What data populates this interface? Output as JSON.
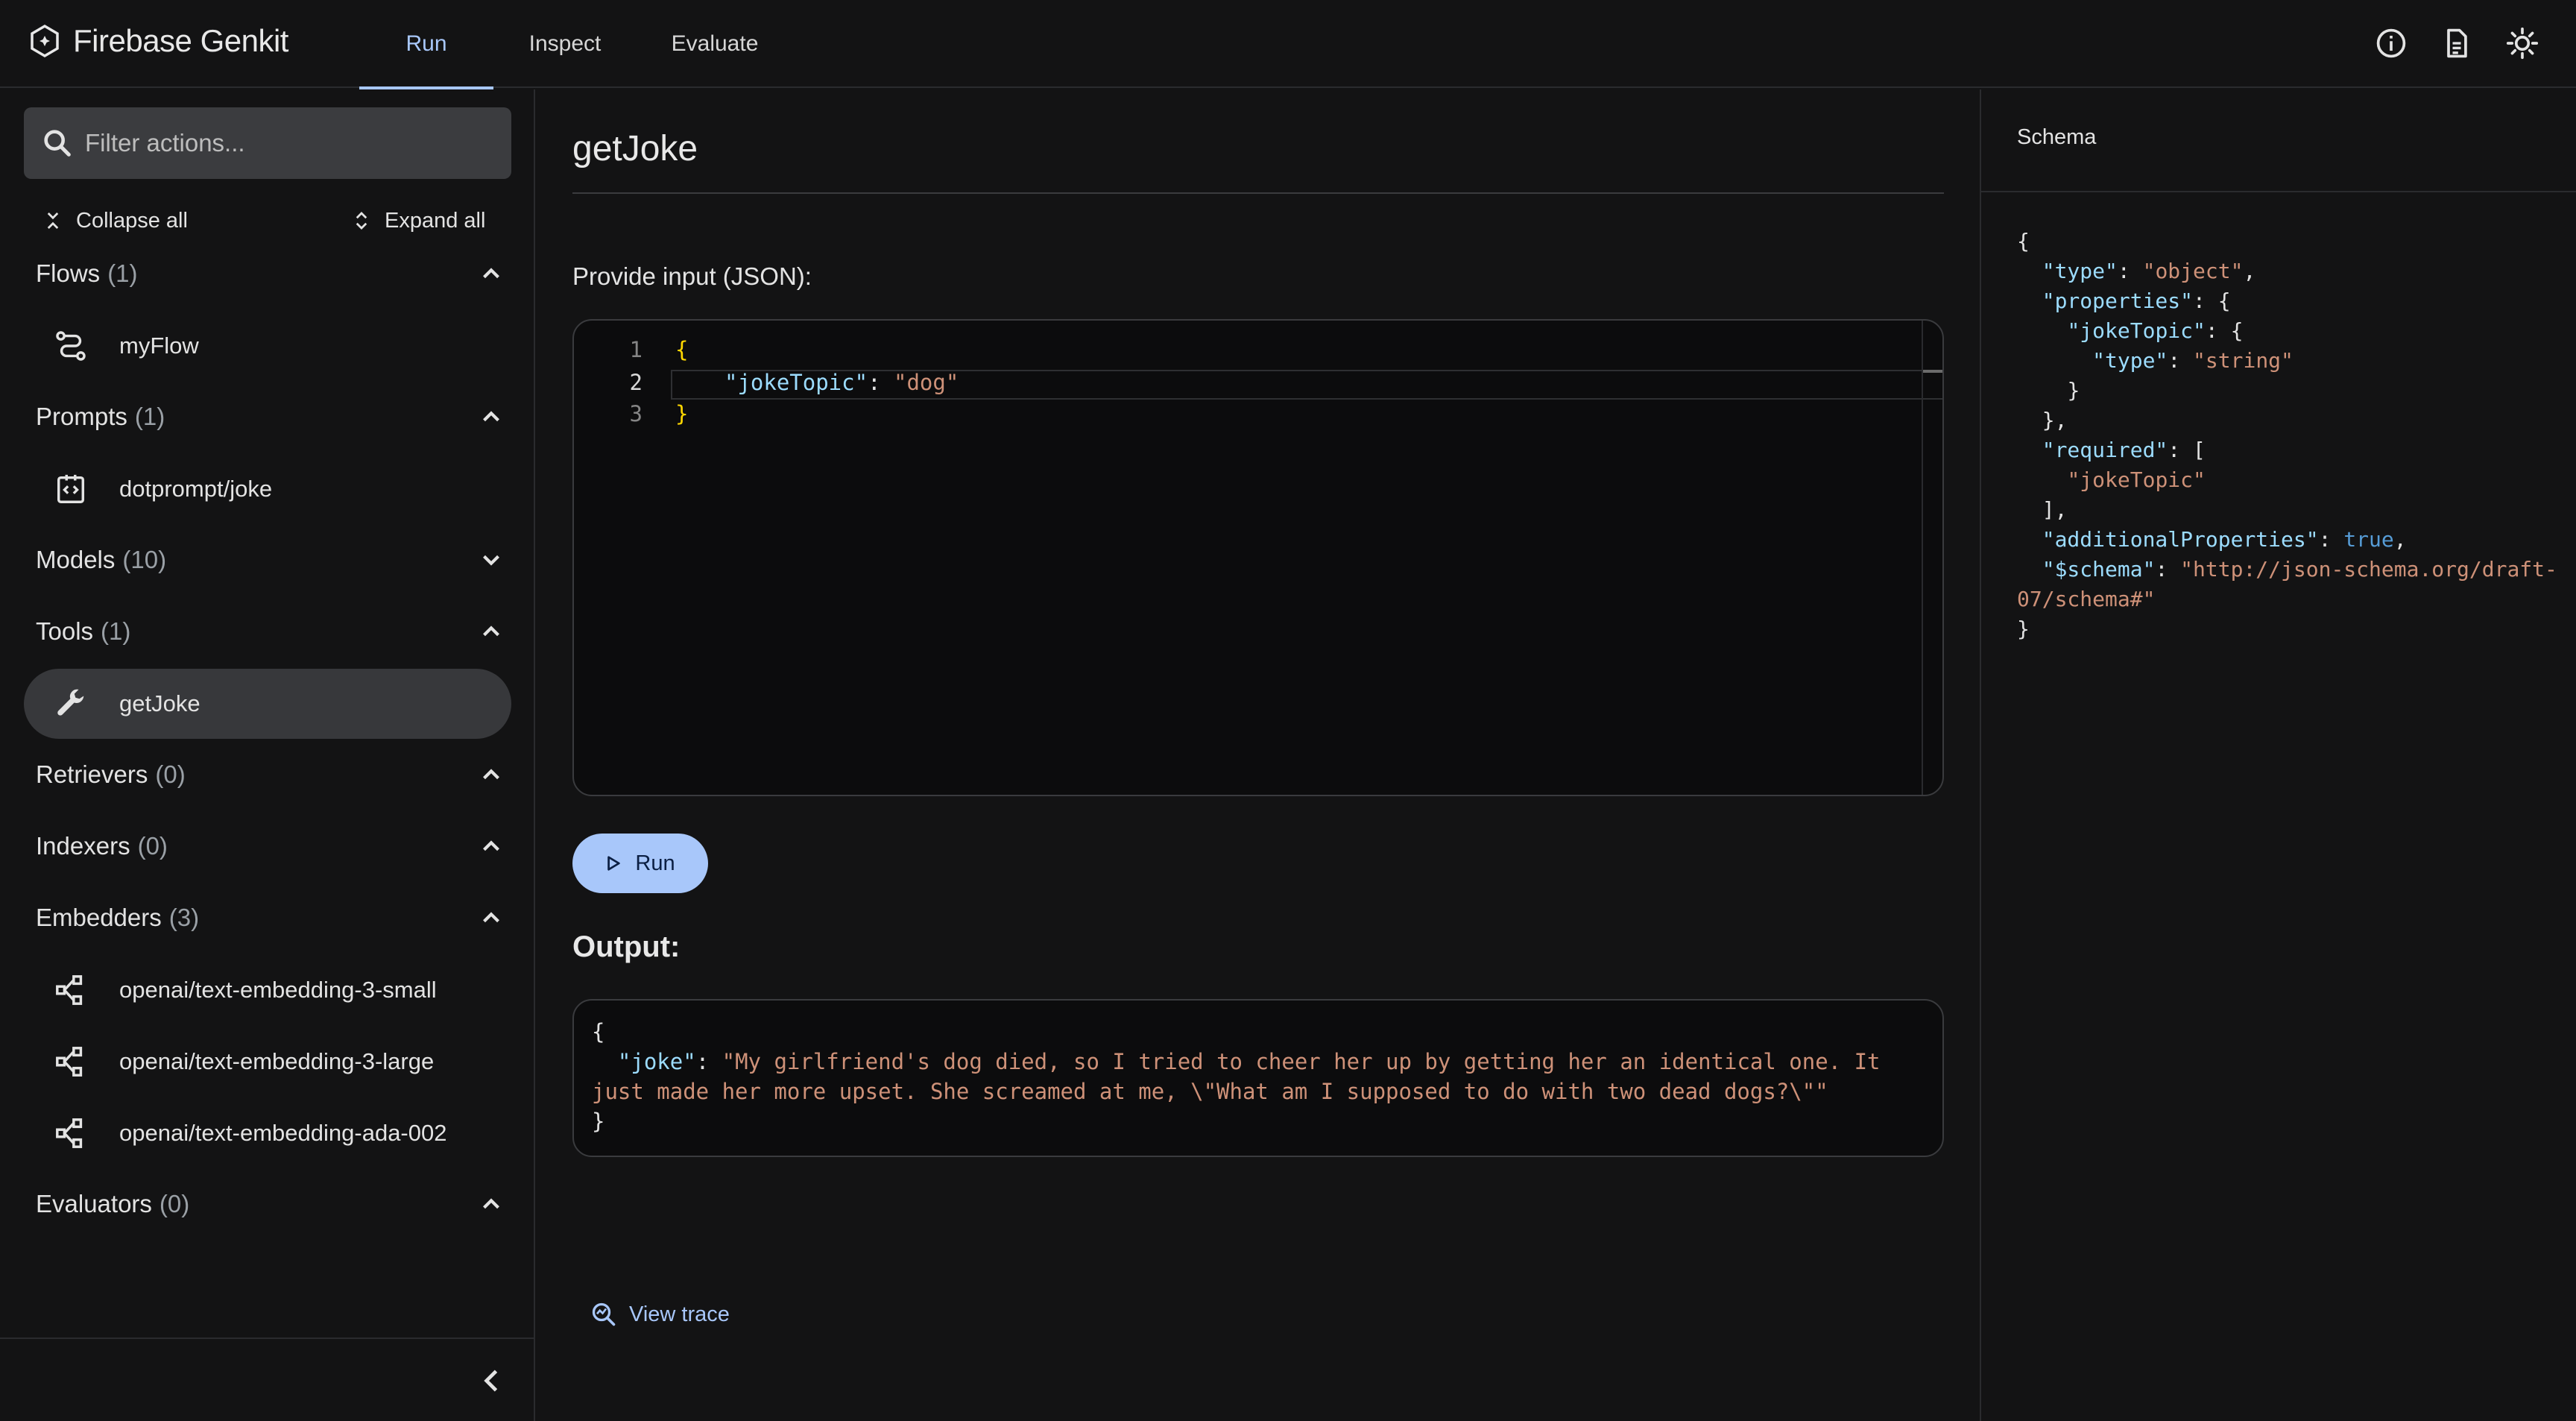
{
  "app": {
    "brand": "Firebase Genkit"
  },
  "nav": {
    "tabs": [
      "Run",
      "Inspect",
      "Evaluate"
    ],
    "active": "Run"
  },
  "top_icons": [
    "info-icon",
    "docs-icon",
    "theme-toggle-icon"
  ],
  "sidebar": {
    "search_placeholder": "Filter actions...",
    "collapse_all": "Collapse all",
    "expand_all": "Expand all",
    "groups": [
      {
        "label": "Flows",
        "count": "(1)",
        "expanded": true,
        "items": [
          {
            "label": "myFlow",
            "icon": "flow-icon"
          }
        ]
      },
      {
        "label": "Prompts",
        "count": "(1)",
        "expanded": true,
        "items": [
          {
            "label": "dotprompt/joke",
            "icon": "prompt-icon"
          }
        ]
      },
      {
        "label": "Models",
        "count": "(10)",
        "expanded": false,
        "items": []
      },
      {
        "label": "Tools",
        "count": "(1)",
        "expanded": true,
        "items": [
          {
            "label": "getJoke",
            "icon": "wrench-icon",
            "selected": true
          }
        ]
      },
      {
        "label": "Retrievers",
        "count": "(0)",
        "expanded": true,
        "items": []
      },
      {
        "label": "Indexers",
        "count": "(0)",
        "expanded": true,
        "items": []
      },
      {
        "label": "Embedders",
        "count": "(3)",
        "expanded": true,
        "items": [
          {
            "label": "openai/text-embedding-3-small",
            "icon": "embedder-icon"
          },
          {
            "label": "openai/text-embedding-3-large",
            "icon": "embedder-icon"
          },
          {
            "label": "openai/text-embedding-ada-002",
            "icon": "embedder-icon"
          }
        ]
      },
      {
        "label": "Evaluators",
        "count": "(0)",
        "expanded": true,
        "items": []
      }
    ]
  },
  "main": {
    "title": "getJoke",
    "input_label": "Provide input (JSON):",
    "editor": {
      "line_numbers": [
        "1",
        "2",
        "3"
      ],
      "current_line": 2,
      "lines": {
        "open": "{",
        "key": "\"jokeTopic\"",
        "colon": ": ",
        "value": "\"dog\"",
        "close": "}"
      }
    },
    "run_label": "Run",
    "output_label": "Output:",
    "output": {
      "open": "{",
      "key": "\"joke\"",
      "colon": ": ",
      "value": "\"My girlfriend's dog died, so I tried to cheer her up by getting her an identical one. It just made her more upset. She screamed at me, \\\"What am I supposed to do with two dead dogs?\\\"\"",
      "close": "}"
    },
    "view_trace": "View trace"
  },
  "schema": {
    "title": "Schema",
    "lines": {
      "l1": "{",
      "type_key": "\"type\"",
      "type_val": "\"object\"",
      "props_key": "\"properties\"",
      "topic_key": "\"jokeTopic\"",
      "topic_type_key": "\"type\"",
      "topic_type_val": "\"string\"",
      "required_key": "\"required\"",
      "required_val": "\"jokeTopic\"",
      "addl_key": "\"additionalProperties\"",
      "addl_val": "true",
      "schema_key": "\"$schema\"",
      "schema_val": "\"http://json-schema.org/draft-07/schema#\"",
      "last": "}"
    }
  },
  "colors": {
    "accent": "#a8c7fa",
    "background": "#131314",
    "editor_bg": "#0c0c0d"
  }
}
